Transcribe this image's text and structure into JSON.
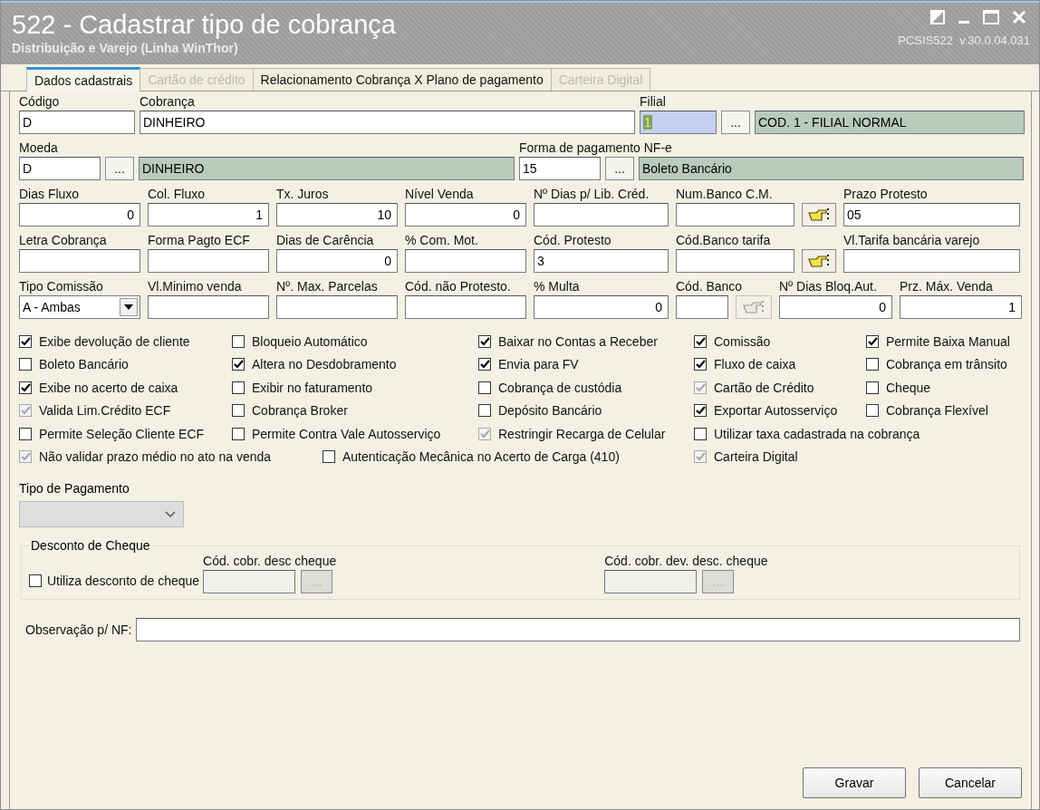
{
  "window": {
    "title": "522 - Cadastrar tipo de cobrança",
    "subtitle": "Distribuição e Varejo (Linha WinThor)",
    "version": "PCSIS522  v.30.0.04.031"
  },
  "tabs": [
    {
      "label": "Dados cadastrais",
      "selected": true,
      "disabled": false
    },
    {
      "label": "Cartão de crédito",
      "selected": false,
      "disabled": true
    },
    {
      "label": "Relacionamento Cobrança X Plano de pagamento",
      "selected": false,
      "disabled": false
    },
    {
      "label": "Carteira Digital",
      "selected": false,
      "disabled": true
    }
  ],
  "field_rows": [
    [
      {
        "label": "Código",
        "value": "D",
        "kind": "text"
      },
      {
        "label": "Cobrança",
        "value": "DINHEIRO",
        "kind": "text"
      },
      {
        "label": "Filial",
        "value": "1",
        "kind": "focused"
      },
      {
        "value": "...",
        "kind": "lookup"
      },
      {
        "value": "COD. 1 - FILIAL NORMAL",
        "kind": "readonly"
      }
    ],
    [
      {
        "label": "Moeda",
        "value": "D",
        "kind": "text"
      },
      {
        "value": "...",
        "kind": "lookup"
      },
      {
        "value": "DINHEIRO",
        "kind": "readonly"
      },
      {
        "label": "Forma de pagamento NF-e",
        "value": "15",
        "kind": "text"
      },
      {
        "value": "...",
        "kind": "lookup"
      },
      {
        "value": "Boleto Bancário",
        "kind": "readonly"
      }
    ],
    [
      {
        "label": "Dias Fluxo",
        "value": "0",
        "kind": "number"
      },
      {
        "label": "Col. Fluxo",
        "value": "1",
        "kind": "number"
      },
      {
        "label": "Tx. Juros",
        "value": "10",
        "kind": "number"
      },
      {
        "label": "Nível Venda",
        "value": "0",
        "kind": "number"
      },
      {
        "label": "Nº Dias p/ Lib. Créd.",
        "kind": "text"
      },
      {
        "label": "Num.Banco C.M.",
        "kind": "text"
      },
      {
        "kind": "picker"
      },
      {
        "label": "Prazo Protesto",
        "value": "05",
        "kind": "text"
      }
    ],
    [
      {
        "label": "Letra Cobrança",
        "kind": "text"
      },
      {
        "label": "Forma Pagto ECF",
        "kind": "text"
      },
      {
        "label": "Dias de Carência",
        "value": "0",
        "kind": "number"
      },
      {
        "label": "% Com. Mot.",
        "kind": "text"
      },
      {
        "label": "Cód. Protesto",
        "value": "3",
        "kind": "text"
      },
      {
        "label": "Cód.Banco tarifa",
        "kind": "text"
      },
      {
        "kind": "picker"
      },
      {
        "label": "Vl.Tarifa bancária varejo",
        "kind": "text"
      }
    ],
    [
      {
        "label": "Tipo Comissão",
        "value": "A - Ambas",
        "kind": "select"
      },
      {
        "label": "Vl.Minimo venda",
        "kind": "text"
      },
      {
        "label": "Nº. Max. Parcelas",
        "kind": "text"
      },
      {
        "label": "Cód. não Protesto.",
        "kind": "text"
      },
      {
        "label": "% Multa",
        "value": "0",
        "kind": "number"
      },
      {
        "label": "Cód. Banco",
        "kind": "text"
      },
      {
        "kind": "inactive-picker"
      },
      {
        "label": "Nº Dias Bloq.Aut.",
        "value": "0",
        "kind": "number"
      },
      {
        "label": "Prz. Máx. Venda",
        "value": "1",
        "kind": "number"
      }
    ]
  ],
  "checkbox_rows": [
    [
      {
        "label": "Exibe devolução de cliente",
        "checked": true,
        "disabled": false
      },
      {
        "label": "Bloqueio Automático",
        "checked": false,
        "disabled": false
      },
      {
        "label": "Baixar no Contas a Receber",
        "checked": true,
        "disabled": false
      },
      {
        "label": "Comissão",
        "checked": true,
        "disabled": false
      },
      {
        "label": "Permite Baixa Manual",
        "checked": true,
        "disabled": false
      }
    ],
    [
      {
        "label": "Boleto Bancário",
        "checked": false,
        "disabled": false
      },
      {
        "label": "Altera no Desdobramento",
        "checked": true,
        "disabled": false
      },
      {
        "label": "Envia para FV",
        "checked": true,
        "disabled": false
      },
      {
        "label": "Fluxo de caixa",
        "checked": true,
        "disabled": false
      },
      {
        "label": "Cobrança em trânsito",
        "checked": false,
        "disabled": false
      }
    ],
    [
      {
        "label": "Exibe no acerto de caixa",
        "checked": true,
        "disabled": false
      },
      {
        "label": "Exibir no faturamento",
        "checked": false,
        "disabled": false
      },
      {
        "label": "Cobrança de custódia",
        "checked": false,
        "disabled": false
      },
      {
        "label": "Cartão de Crédito",
        "checked": true,
        "disabled": true
      },
      {
        "label": "Cheque",
        "checked": false,
        "disabled": false
      }
    ],
    [
      {
        "label": "Valida Lim.Crédito ECF",
        "checked": true,
        "disabled": true
      },
      {
        "label": "Cobrança Broker",
        "checked": false,
        "disabled": false
      },
      {
        "label": "Depósito Bancário",
        "checked": false,
        "disabled": false
      },
      {
        "label": "Exportar Autosserviço",
        "checked": true,
        "disabled": false
      },
      {
        "label": "Cobrança Flexível",
        "checked": false,
        "disabled": false
      }
    ],
    [
      {
        "label": "Permite Seleção Cliente ECF",
        "checked": false,
        "disabled": false
      },
      {
        "label": "Permite Contra Vale Autosserviço",
        "checked": false,
        "disabled": false
      },
      {
        "label": "Restringir Recarga de Celular",
        "checked": true,
        "disabled": true
      },
      {
        "label": "Utilizar taxa cadastrada na cobrança",
        "checked": false,
        "disabled": false
      }
    ],
    [
      {
        "label": "Não validar prazo médio no ato na venda",
        "checked": true,
        "disabled": true
      },
      {
        "label": "Autenticação Mecânica no Acerto de Carga (410)",
        "checked": false,
        "disabled": false
      },
      {
        "label": "Carteira Digital",
        "checked": true,
        "disabled": true
      }
    ]
  ],
  "payment_type": {
    "label": "Tipo de Pagamento",
    "disabled": true
  },
  "cheque_discount": {
    "title": "Desconto de Cheque",
    "checkbox": {
      "label": "Utiliza desconto de cheque",
      "checked": false
    },
    "fields": [
      {
        "label": "Cód. cobr. desc cheque",
        "button": "..."
      },
      {
        "label": "Cód. cobr. dev. desc. cheque",
        "button": "..."
      }
    ]
  },
  "observation": {
    "label": "Observação p/ NF:"
  },
  "buttons": [
    "Gravar",
    "Cancelar"
  ]
}
